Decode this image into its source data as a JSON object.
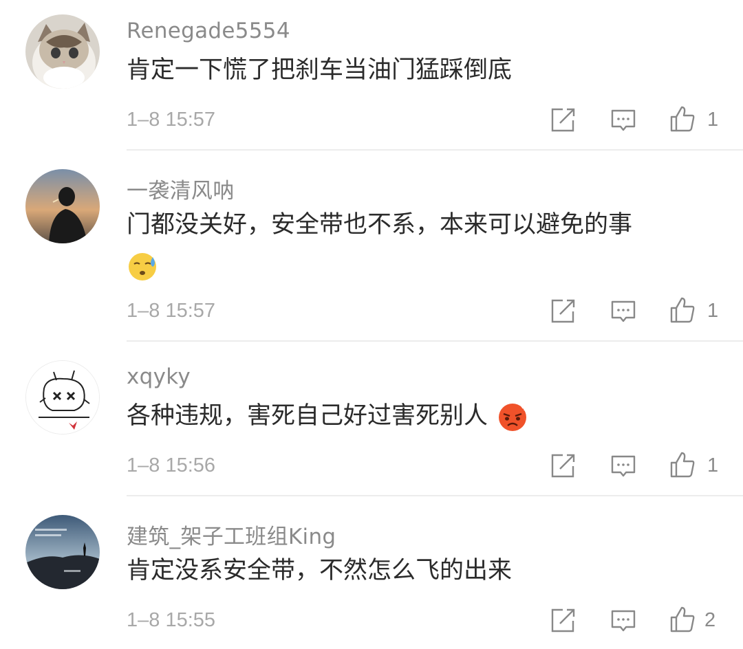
{
  "comments": [
    {
      "username": "Renegade5554",
      "content": "肯定一下慌了把刹车当油门猛踩倒底",
      "time": "1–8 15:57",
      "likes": "1"
    },
    {
      "username": "一袭清风呐",
      "content": "门都没关好，安全带也不系，本来可以避免的事",
      "emoji": "sweat-face",
      "time": "1–8 15:57",
      "likes": "1"
    },
    {
      "username": "xqyky",
      "content": "各种违规，害死自己好过害死别人",
      "emoji": "angry-face",
      "time": "1–8 15:56",
      "likes": "1"
    },
    {
      "username": "建筑_架子工班组King",
      "content": "肯定没系安全带，不然怎么飞的出来",
      "time": "1–8 15:55",
      "likes": "2"
    }
  ],
  "icons": {
    "share": "share-icon",
    "reply": "comment-icon",
    "like": "thumbs-up-icon"
  },
  "colors": {
    "username": "#8a8a8a",
    "text": "#2b2b2b",
    "meta": "#a8a8a8",
    "divider": "#ececec"
  }
}
